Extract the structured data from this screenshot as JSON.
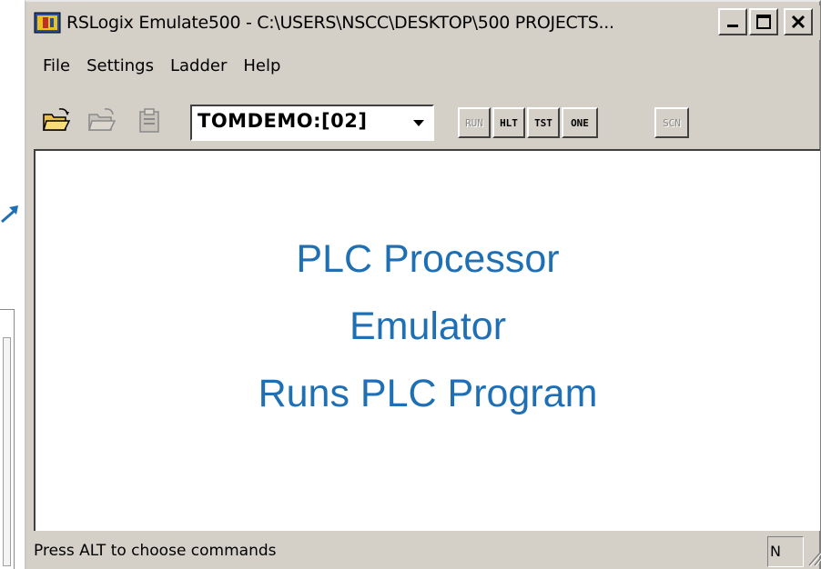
{
  "window": {
    "title": "RSLogix Emulate500 - C:\\USERS\\NSCC\\DESKTOP\\500 PROJECTS...",
    "controls": {
      "minimize": "minimize-icon",
      "maximize": "maximize-icon",
      "close": "close-icon"
    }
  },
  "menu": {
    "items": [
      {
        "label": "File"
      },
      {
        "label": "Settings"
      },
      {
        "label": "Ladder"
      },
      {
        "label": "Help"
      }
    ]
  },
  "toolbar": {
    "icons": [
      "open-folder-icon",
      "open-folder-disabled-icon",
      "clipboard-disabled-icon"
    ],
    "processor_select": {
      "value": "TOMDEMO:[02]"
    },
    "mode_buttons": {
      "run": "RUN",
      "hlt": "HLT",
      "tst": "TST",
      "one": "ONE",
      "scn": "SCN"
    }
  },
  "overlay_text": {
    "line1": "PLC Processor",
    "line2": "Emulator",
    "line3": "Runs PLC Program"
  },
  "status": {
    "text": "Press ALT to choose commands",
    "pane": "N"
  },
  "colors": {
    "overlay": "#1f6fb4",
    "window_face": "#d4d0c8"
  }
}
